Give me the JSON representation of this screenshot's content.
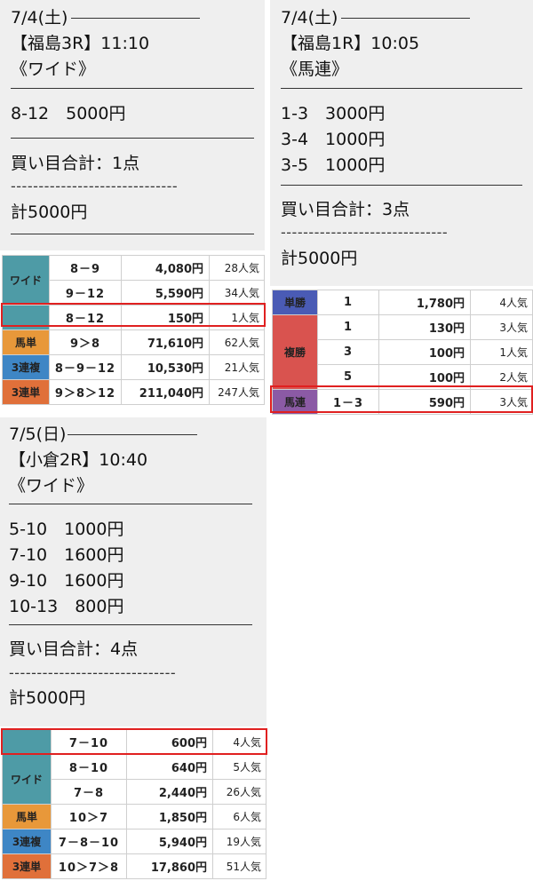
{
  "ticket1": {
    "date": "7/4(土)",
    "race": "【福島3R】11:10",
    "type": "《ワイド》",
    "bets": [
      "8-12　5000円"
    ],
    "count": "買い目合計：1点",
    "dashes": "------------------------------",
    "total": "計5000円"
  },
  "ticket2": {
    "date": "7/4(土)",
    "race": "【福島1R】10:05",
    "type": "《馬連》",
    "bets": [
      "1-3　3000円",
      "3-4　1000円",
      "3-5　1000円"
    ],
    "count": "買い目合計：3点",
    "dashes": "------------------------------",
    "total": "計5000円"
  },
  "ticket3": {
    "date": "7/5(日)",
    "race": "【小倉2R】10:40",
    "type": "《ワイド》",
    "bets": [
      "5-10　1000円",
      "7-10　1600円",
      "9-10　1600円",
      "10-13　800円"
    ],
    "count": "買い目合計：4点",
    "dashes": "------------------------------",
    "total": "計5000円"
  },
  "results1": {
    "wide_label": "ワイド",
    "rows": [
      {
        "combo": "8－9",
        "pay": "4,080円",
        "pop": "28人気"
      },
      {
        "combo": "9－12",
        "pay": "5,590円",
        "pop": "34人気"
      },
      {
        "combo": "8－12",
        "pay": "150円",
        "pop": "1人気"
      }
    ],
    "umatan": {
      "label": "馬単",
      "combo": "9＞8",
      "pay": "71,610円",
      "pop": "62人気"
    },
    "sanrenpuku": {
      "label": "3連複",
      "combo": "8－9－12",
      "pay": "10,530円",
      "pop": "21人気"
    },
    "sanrentan": {
      "label": "3連単",
      "combo": "9＞8＞12",
      "pay": "211,040円",
      "pop": "247人気"
    }
  },
  "results2": {
    "tansho": {
      "label": "単勝",
      "combo": "1",
      "pay": "1,780円",
      "pop": "4人気"
    },
    "fukusho_label": "複勝",
    "fukusho": [
      {
        "combo": "1",
        "pay": "130円",
        "pop": "3人気"
      },
      {
        "combo": "3",
        "pay": "100円",
        "pop": "1人気"
      },
      {
        "combo": "5",
        "pay": "100円",
        "pop": "2人気"
      }
    ],
    "umaren": {
      "label": "馬連",
      "combo": "1－3",
      "pay": "590円",
      "pop": "3人気"
    }
  },
  "results3": {
    "wide_label": "ワイド",
    "rows": [
      {
        "combo": "7－10",
        "pay": "600円",
        "pop": "4人気"
      },
      {
        "combo": "8－10",
        "pay": "640円",
        "pop": "5人気"
      },
      {
        "combo": "7－8",
        "pay": "2,440円",
        "pop": "26人気"
      }
    ],
    "umatan": {
      "label": "馬単",
      "combo": "10＞7",
      "pay": "1,850円",
      "pop": "6人気"
    },
    "sanrenpuku": {
      "label": "3連複",
      "combo": "7－8－10",
      "pay": "5,940円",
      "pop": "19人気"
    },
    "sanrentan": {
      "label": "3連単",
      "combo": "10＞7＞8",
      "pay": "17,860円",
      "pop": "51人気"
    }
  },
  "colors": {
    "highlight": "#e02020",
    "panel": "#efefef",
    "wide": "#4e9ba6",
    "umatan": "#e8983a",
    "sanrenpuku": "#3e86c5",
    "sanrentan": "#e0703a",
    "tansho": "#4a5bb5",
    "fukusho": "#d9534f",
    "umaren": "#8b5aa5"
  }
}
